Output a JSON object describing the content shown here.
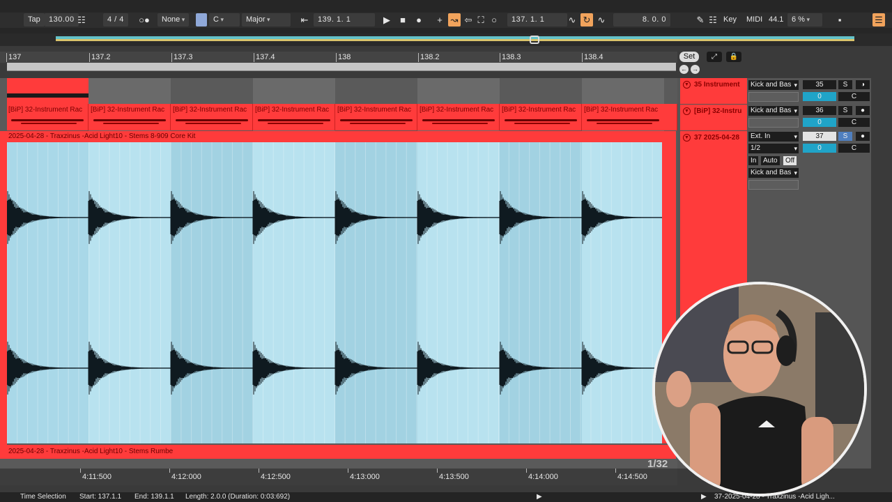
{
  "transport": {
    "tap": "Tap",
    "tempo": "130.00",
    "signature": "4 / 4",
    "groove": "None",
    "key": "C",
    "scale": "Major",
    "arrangement_pos": "139.   1.   1",
    "loop_start": "137.   1.   1",
    "loop_length": "8.   0.   0",
    "key_label": "Key",
    "midi_label": "MIDI",
    "sample_rate": "44.1",
    "cpu": "6 %"
  },
  "ruler": {
    "ticks": [
      "137",
      "137.2",
      "137.3",
      "137.4",
      "138",
      "138.2",
      "138.3",
      "138.4"
    ],
    "set_label": "Set"
  },
  "clips": {
    "lane36_clip": "[BiP] 32-Instrument Rac",
    "track37_clip": "2025-04-28 - Traxzinus -Acid Light10 - Stems 8-909 Core Kit",
    "track38_clip": "2025-04-28 - Traxzinus -Acid Light10 - Stems Rumbe"
  },
  "tracks": [
    {
      "name": "35 Instrument",
      "io": "Kick and Bas",
      "volume": "35",
      "pan": "0"
    },
    {
      "name": "[BiP] 32-Instru",
      "io": "Kick and Bas",
      "volume": "36",
      "pan": "0"
    },
    {
      "name": "37 2025-04-28",
      "io": "Ext. In",
      "channel": "1/2",
      "monitor": [
        "In",
        "Auto",
        "Off"
      ],
      "output": "Kick and Bas",
      "volume": "37",
      "pan": "0"
    }
  ],
  "track_buttons": {
    "solo": "S",
    "center": "C"
  },
  "time_labels": [
    "4:11:500",
    "4:12:000",
    "4:12:500",
    "4:13:000",
    "4:13:500",
    "4:14:000",
    "4:14:500"
  ],
  "grid_size": "1/32",
  "status": {
    "mode": "Time Selection",
    "start": "Start: 137.1.1",
    "end": "End: 139.1.1",
    "length": "Length: 2.0.0  (Duration: 0:03:692)",
    "detail_clip": "37-2025-04-28 - Traxzinus -Acid Ligh..."
  },
  "colors": {
    "track_red": "#ff3b3b",
    "waveform_bg": "#a9d8e8",
    "pan_blue": "#20a4c8",
    "accent_orange": "#f1a35c"
  }
}
